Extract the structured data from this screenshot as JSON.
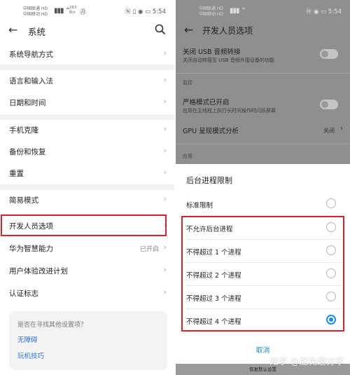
{
  "left": {
    "status": {
      "carrier_top": "中国联通 HD",
      "carrier_bottom": "中国移动 HD",
      "speed_top": "263",
      "speed_bottom": "B/s",
      "misc": "㊊",
      "time": "5:54"
    },
    "title": "系统",
    "items": {
      "nav": "系统导航方式",
      "language": "语言和输入法",
      "datetime": "日期和时间",
      "clone": "手机克隆",
      "backup": "备份和恢复",
      "reset": "重置",
      "simple": "简易模式",
      "developer": "开发人员选项",
      "smart": "华为智慧能力",
      "smart_value": "已开启",
      "ux": "用户体验改进计划",
      "cert": "认证标志"
    },
    "suggestion": {
      "question": "是否在寻找其他设置项？",
      "link1": "无障碍",
      "link2": "玩机技巧"
    }
  },
  "right": {
    "status": {
      "carrier_top": "中国联通 HD",
      "carrier_bottom": "中国移动 HD",
      "time": "5:54"
    },
    "title": "开发人员选项",
    "usb_title": "关闭 USB 音频转接",
    "usb_sub": "关闭自动转接至 USB 音频外围设备的功能",
    "section_monitor": "监控",
    "strict_title": "严格模式已开启",
    "strict_sub": "应用在主线程上执行长时间操作时闪烁屏幕",
    "gpu_title": "GPU 呈现模式分析",
    "gpu_value": "关闭",
    "section_apps": "应用",
    "dialog": {
      "title": "后台进程限制",
      "options": [
        {
          "label": "标准限制",
          "selected": false
        },
        {
          "label": "不允许后台进程",
          "selected": false
        },
        {
          "label": "不得超过 1 个进程",
          "selected": false
        },
        {
          "label": "不得超过 2 个进程",
          "selected": false
        },
        {
          "label": "不得超过 3 个进程",
          "selected": false
        },
        {
          "label": "不得超过 4 个进程",
          "selected": true
        }
      ],
      "cancel": "取消"
    },
    "bottom_label": "恢复默认设置",
    "watermark": "知乎 @肥兔趣分享"
  },
  "colors": {
    "highlight": "#d9222a",
    "accent": "#1a8fe3",
    "link": "#2f6fd6"
  },
  "icons": [
    "back-arrow-icon",
    "search-icon",
    "chevron-right-icon",
    "radio-icon",
    "toggle-icon"
  ]
}
